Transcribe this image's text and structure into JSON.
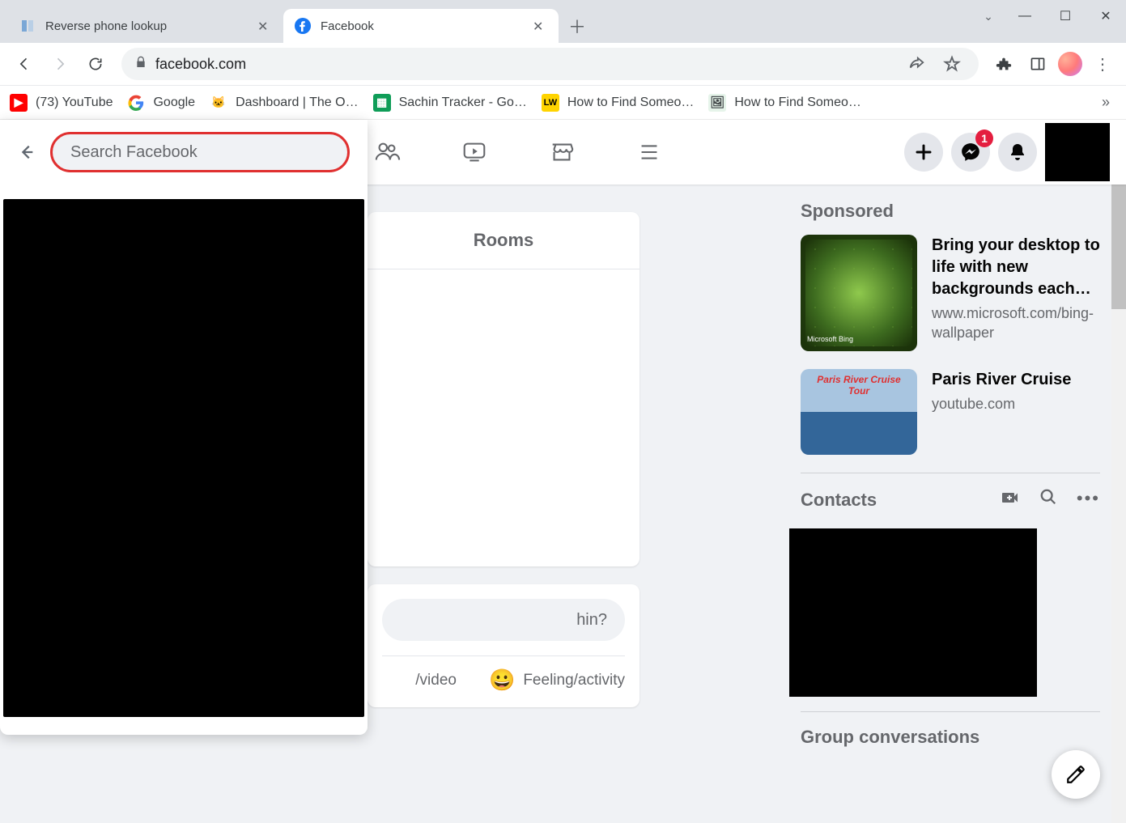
{
  "browser": {
    "tabs": [
      {
        "title": "Reverse phone lookup",
        "active": false
      },
      {
        "title": "Facebook",
        "active": true
      }
    ],
    "addressbar": "facebook.com",
    "bookmarks": [
      {
        "label": "(73) YouTube",
        "icon": "yt"
      },
      {
        "label": "Google",
        "icon": "google"
      },
      {
        "label": "Dashboard | The O…",
        "icon": "cat"
      },
      {
        "label": "Sachin Tracker - Go…",
        "icon": "sheets"
      },
      {
        "label": "How to Find Someo…",
        "icon": "lw"
      },
      {
        "label": "How to Find Someo…",
        "icon": "pic"
      }
    ]
  },
  "facebook": {
    "search_placeholder": "Search Facebook",
    "messenger_badge": "1",
    "feed": {
      "rooms_title": "Rooms",
      "composer_placeholder_fragment": "hin?",
      "composer_actions": {
        "photo_video_fragment": "/video",
        "feeling": "Feeling/activity"
      }
    },
    "sponsored": {
      "title": "Sponsored",
      "items": [
        {
          "title": "Bring your desktop to life with new backgrounds each…",
          "url": "www.microsoft.com/bing-wallpaper",
          "bing_tag": "Microsoft Bing"
        },
        {
          "title": "Paris River Cruise",
          "url": "youtube.com"
        }
      ]
    },
    "contacts": {
      "title": "Contacts",
      "group_conversations": "Group conversations"
    }
  }
}
